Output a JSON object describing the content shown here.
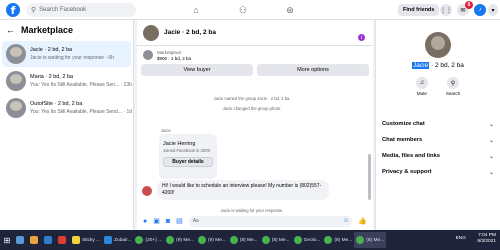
{
  "topbar": {
    "logo": "f",
    "search_placeholder": "Search Facebook",
    "find_friends_label": "Find friends",
    "notification_count": "6"
  },
  "left_panel": {
    "title": "Marketplace",
    "conversations": [
      {
        "title": "Jacie · 2 bd, 2 ba",
        "subtitle": "Jacie is waiting for your response · 6h",
        "active": true
      },
      {
        "title": "Maria · 2 bd, 2 ba",
        "subtitle": "You: Yes Its Still Available, Please Sen... · 23h",
        "active": false
      },
      {
        "title": "OutofSite · 2 bd, 2 ba",
        "subtitle": "You: Yes Its Still Available, Please Send... · 1d",
        "active": false
      }
    ]
  },
  "chat": {
    "title": "Jacie · 2 bd, 2 ba",
    "marketplace_label": "Marketplace",
    "listing": "$900 · 2 bd, 2 ba",
    "view_buyer_label": "View buyer",
    "more_options_label": "More options",
    "system_messages": [
      "Jacie named the group Jacie · 2 bd, 2 ba.",
      "Jacie changed the group photo."
    ],
    "sender_name_small": "Jacie",
    "card_name": "Jacie Herring",
    "card_joined": "Joined Facebook in 2009",
    "buyer_details_label": "Buyer details",
    "message": "Hi! I would like to schedule an interview please! My number is (802)557-4200!",
    "waiting_note": "Jacie is waiting for your response.",
    "composer_placeholder": "Aa"
  },
  "right_panel": {
    "name_highlight": "Jacie",
    "name_rest": " · 2 bd, 2 ba",
    "mute_label": "Mute",
    "search_label": "Search",
    "sections": [
      "Customize chat",
      "Chat members",
      "Media, files and links",
      "Privacy & support"
    ]
  },
  "taskbar": {
    "items": [
      "Sticky ...",
      "Zubair...",
      "(20+) ...",
      "(9) Me...",
      "(9) Me...",
      "(8) Me...",
      "(8) Me...",
      "Geolo...",
      "(8) Me...",
      "(8) Me..."
    ],
    "time": "7:04 PM",
    "date": "9/3/2021",
    "lang": "ENG"
  },
  "colors": {
    "accent": "#1877f2",
    "taskbar": "#20243a",
    "badge": "#e41e3f"
  }
}
